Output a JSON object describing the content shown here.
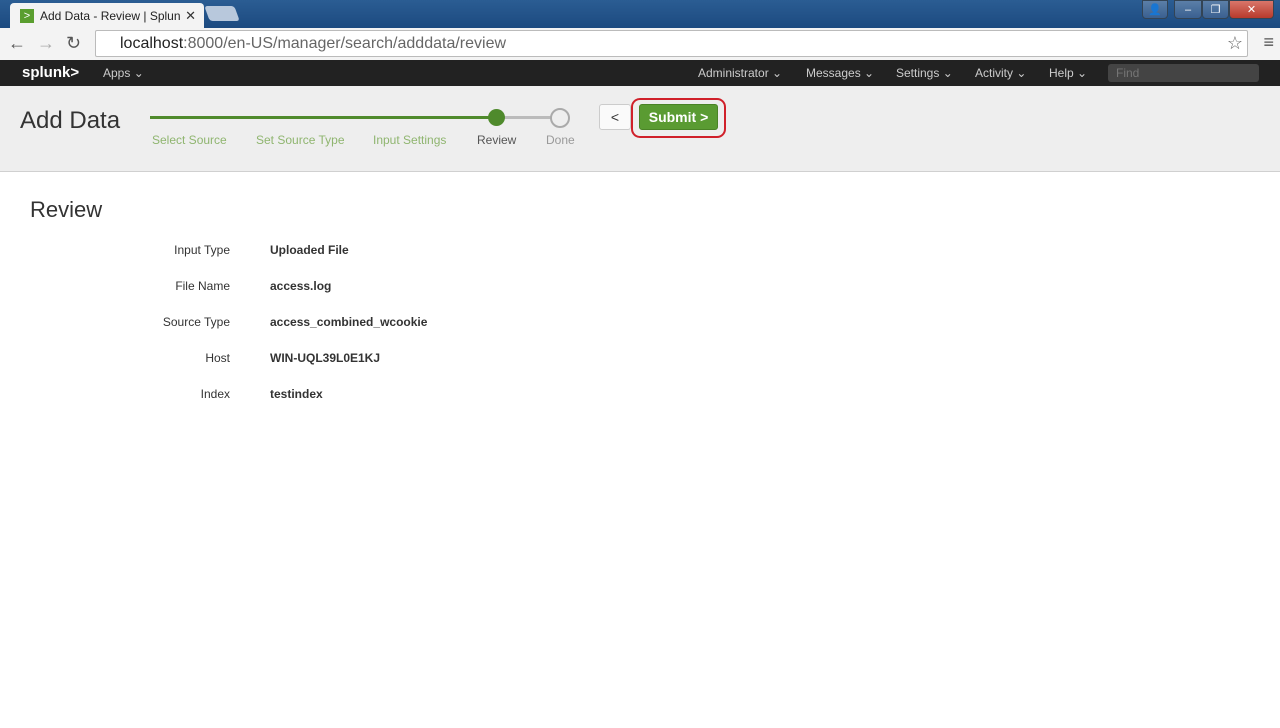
{
  "browser": {
    "tab_title": "Add Data - Review | Splun",
    "url_host": "localhost",
    "url_rest": ":8000/en-US/manager/search/adddata/review"
  },
  "splunkbar": {
    "logo": "splunk>",
    "apps": "Apps",
    "items": [
      "Administrator",
      "Messages",
      "Settings",
      "Activity",
      "Help"
    ],
    "find_placeholder": "Find"
  },
  "header": {
    "title": "Add Data",
    "steps": [
      {
        "label": "Select Source",
        "state": "complete"
      },
      {
        "label": "Set Source Type",
        "state": "complete"
      },
      {
        "label": "Input Settings",
        "state": "complete"
      },
      {
        "label": "Review",
        "state": "current"
      },
      {
        "label": "Done",
        "state": "pending"
      }
    ],
    "back_label": "<",
    "submit_label": "Submit >"
  },
  "review": {
    "title": "Review",
    "rows": [
      {
        "label": "Input Type",
        "value": "Uploaded File"
      },
      {
        "label": "File Name",
        "value": "access.log"
      },
      {
        "label": "Source Type",
        "value": "access_combined_wcookie"
      },
      {
        "label": "Host",
        "value": "WIN-UQL39L0E1KJ"
      },
      {
        "label": "Index",
        "value": "testindex"
      }
    ]
  },
  "colors": {
    "accent": "#5a9b32",
    "highlight": "#d0202a"
  }
}
